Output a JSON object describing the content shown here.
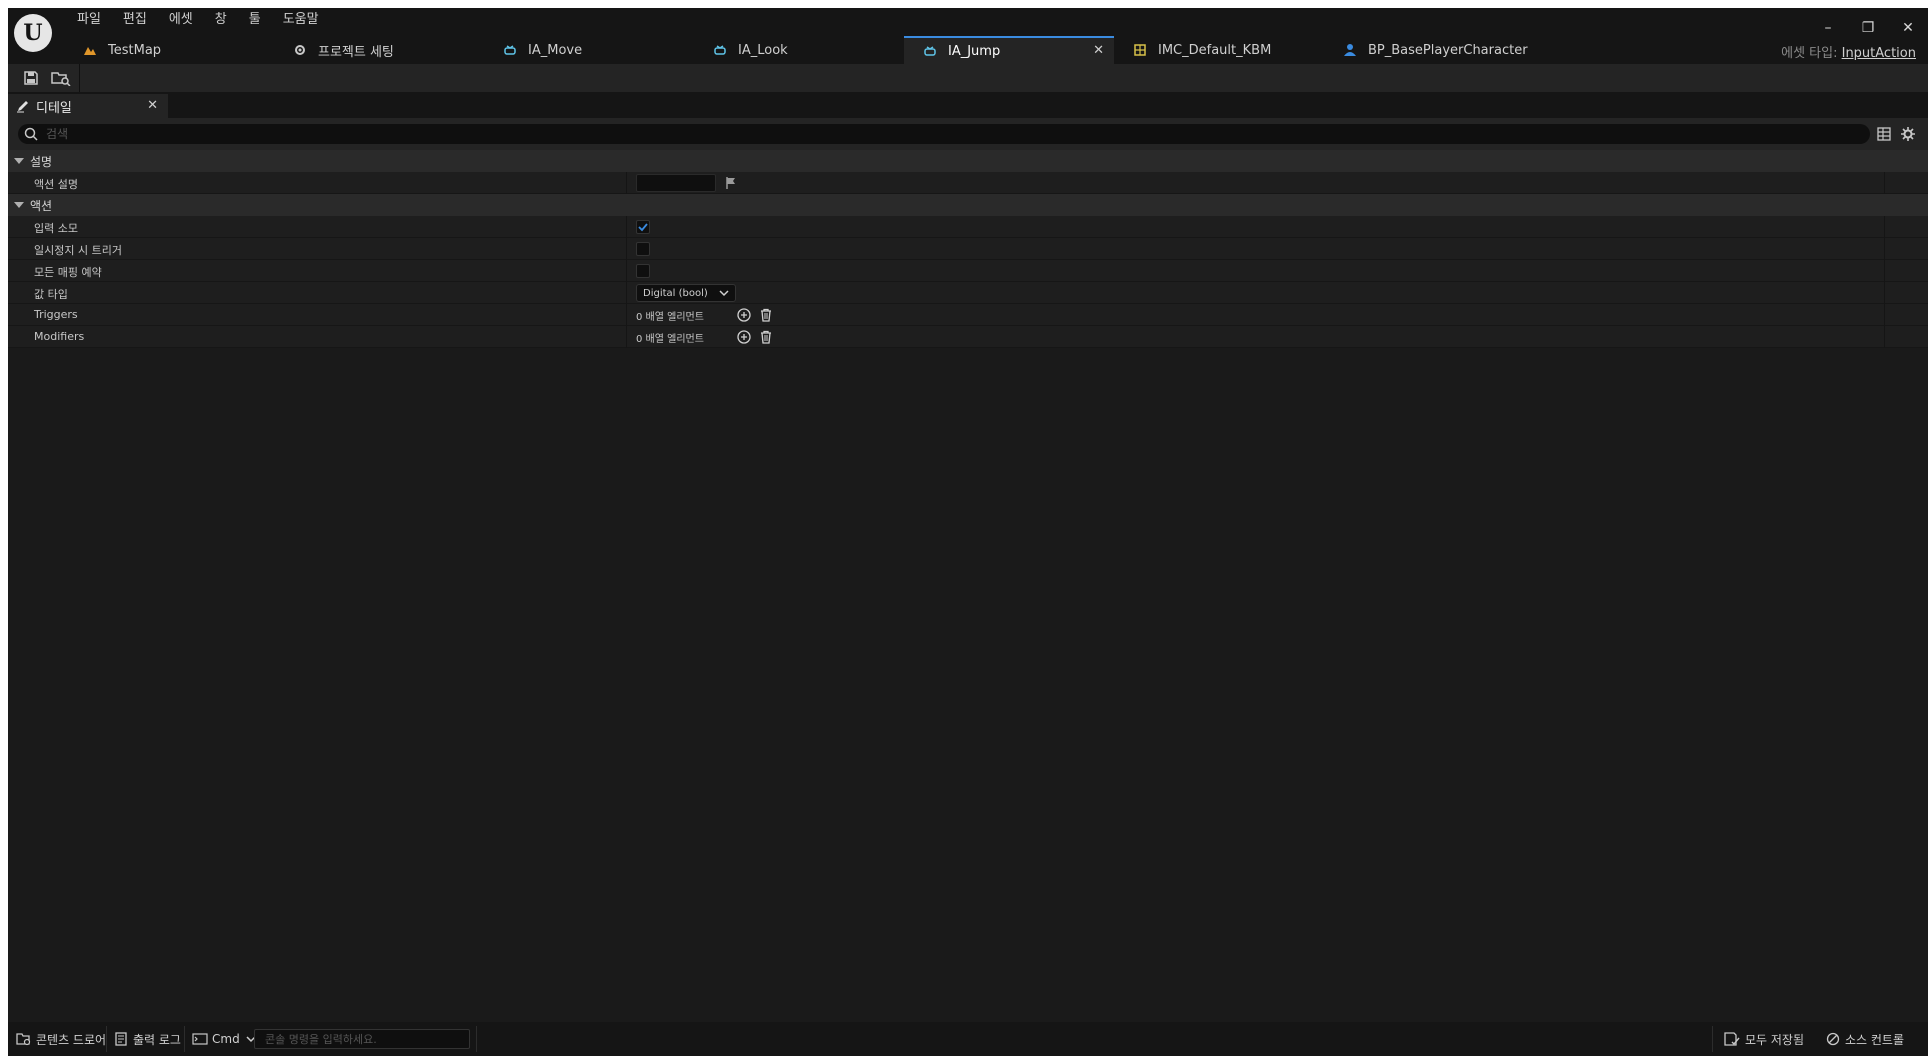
{
  "menu": [
    "파일",
    "편집",
    "에셋",
    "창",
    "툴",
    "도움말"
  ],
  "window_controls": {
    "minimize": "–",
    "restore": "❐",
    "close": "✕"
  },
  "tabs": [
    {
      "label": "TestMap",
      "icon": "map-icon"
    },
    {
      "label": "프로젝트 세팅",
      "icon": "settings-icon"
    },
    {
      "label": "IA_Move",
      "icon": "input-action-icon"
    },
    {
      "label": "IA_Look",
      "icon": "input-action-icon"
    },
    {
      "label": "IA_Jump",
      "icon": "input-action-icon",
      "active": true
    },
    {
      "label": "IMC_Default_KBM",
      "icon": "mapping-context-icon"
    },
    {
      "label": "BP_BasePlayerCharacter",
      "icon": "character-icon"
    }
  ],
  "asset_type": {
    "label": "에셋 타입:",
    "value": "InputAction"
  },
  "panel": {
    "title": "디테일"
  },
  "search": {
    "placeholder": "검색"
  },
  "categories": [
    {
      "label": "설명"
    },
    {
      "label": "액션"
    }
  ],
  "properties": {
    "action_description": {
      "label": "액션 설명"
    },
    "consume_input": {
      "label": "입력 소모",
      "checked": true
    },
    "trigger_when_paused": {
      "label": "일시정지 시 트리거",
      "checked": false
    },
    "reserve_all_mappings": {
      "label": "모든 매핑 예약",
      "checked": false
    },
    "value_type": {
      "label": "값 타입",
      "value": "Digital (bool)"
    },
    "triggers": {
      "label": "Triggers",
      "value": "0 배열 엘리먼트"
    },
    "modifiers": {
      "label": "Modifiers",
      "value": "0 배열 엘리먼트"
    }
  },
  "statusbar": {
    "content_drawer": "콘텐츠 드로어",
    "output_log": "출력 로그",
    "cmd": "Cmd",
    "console_placeholder": "콘솔 명령을 입력하세요.",
    "save_status": "모두 저장됨",
    "source_control": "소스 컨트롤"
  },
  "colors": {
    "accent": "#3a8be0",
    "checkbox_check": "#3a8be0",
    "background": "#1a1a1a"
  }
}
